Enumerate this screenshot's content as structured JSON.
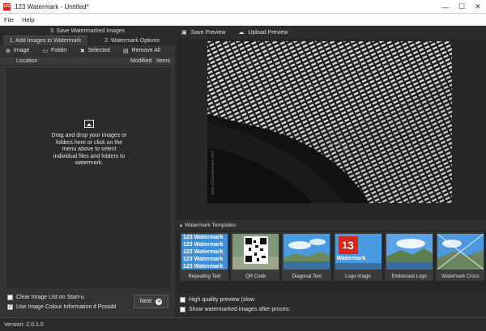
{
  "window": {
    "title": "123 Watermark - Untitled*",
    "app_icon_text": "123"
  },
  "menu": [
    "File",
    "Help"
  ],
  "steps": {
    "save": "3. Save Watermarked Images",
    "add": "1. Add Images to Watermark",
    "options": "2. Watermark Options"
  },
  "toolbar": {
    "image": "Image",
    "folder": "Folder",
    "selected": "Selected",
    "remove_all": "Remove All"
  },
  "list": {
    "col_location": "Location",
    "col_modified": "Modified",
    "col_items": "Items",
    "drop_lines": [
      "Drag and drop your images or",
      "folders here or click on the",
      "menu above to select",
      "individual files and folders to",
      "watermark."
    ]
  },
  "options": {
    "clear_list": "Clear Image List on Start-u",
    "use_colour": "Use Image Colour Information if Possibl",
    "clear_list_checked": false,
    "use_colour_checked": true
  },
  "next_button": "Next",
  "right_toolbar": {
    "save_preview": "Save Preview",
    "upload_preview": "Upload Preview"
  },
  "preview": {
    "watermark_text": "123",
    "side_text": "www.123watermark.com"
  },
  "templates_header": "Watermark Templates",
  "templates": [
    {
      "label": "Repeating Text",
      "overlay": "123 Watermark"
    },
    {
      "label": "QR Code",
      "overlay": ""
    },
    {
      "label": "Diagonal Text",
      "overlay": ""
    },
    {
      "label": "Logo Image",
      "overlay": "Watermark"
    },
    {
      "label": "Embossed Logo",
      "overlay": ""
    },
    {
      "label": "Watermark Cross",
      "overlay": ""
    }
  ],
  "bottom_options": {
    "high_quality": "High quality preview (slow",
    "show_after": "Show watermarked images after proces:"
  },
  "status": {
    "version": "Version: 2.0.1.0"
  },
  "colors": {
    "panel": "#333333",
    "accent_red": "#d9261c",
    "sky_blue": "#3e8fd6"
  }
}
